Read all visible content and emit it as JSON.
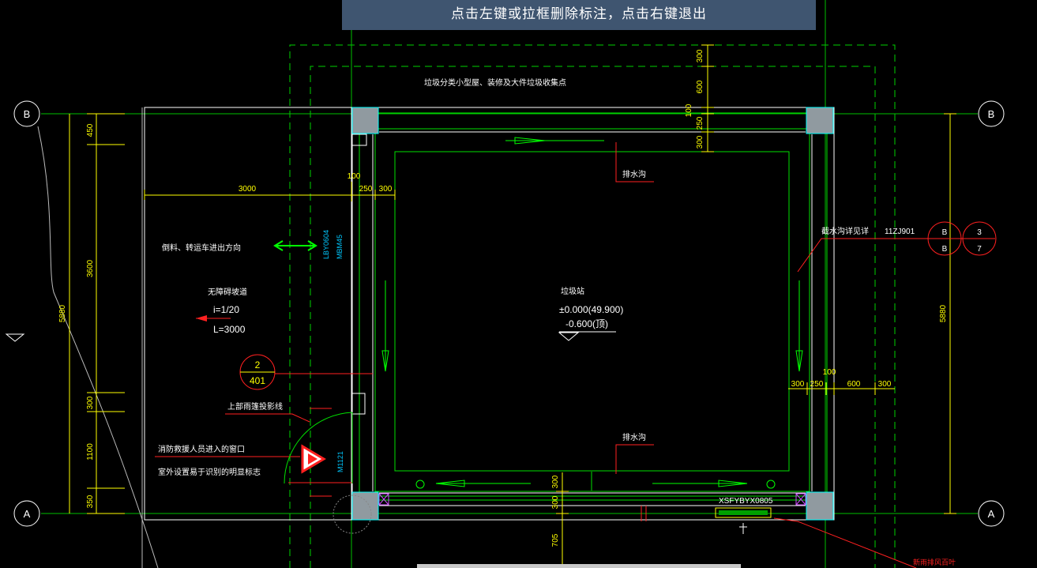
{
  "tooltip": "点击左键或拉框删除标注，点击右键退出",
  "axis": {
    "top_left": "B",
    "top_right": "B",
    "bottom_left": "A",
    "bottom_right": "A"
  },
  "dims": {
    "left_450": "450",
    "left_3600": "3600",
    "left_5880": "5880",
    "left_300": "300",
    "left_1100": "1100",
    "left_350": "350",
    "top_3000": "3000",
    "top_250": "250",
    "top_300": "300",
    "top_100": "100",
    "vtop_300a": "300",
    "vtop_600": "600",
    "vtop_100": "100",
    "vtop_250": "250",
    "vtop_300b": "300",
    "right_5880": "5880",
    "r_300a": "300",
    "r_250": "250",
    "r_100": "100",
    "r_600": "600",
    "r_300b": "300",
    "bottom_300a": "300",
    "bottom_300b": "300",
    "bottom_705": "705"
  },
  "labels": {
    "recycle_note": "垃圾分类小型屋、装修及大件垃圾收集点",
    "drain_top": "排水沟",
    "drain_bottom": "排水沟",
    "trench_right": "截水沟详见详",
    "detail_code": "11ZJ901",
    "detail_b_top": "B",
    "detail_b_bottom": "B",
    "detail_3": "3",
    "detail_7": "7",
    "station": "垃圾站",
    "elev_main": "±0.000(49.900)",
    "elev_sub": "-0.600(顶)",
    "truck_dir": "倒料、转运车进出方向",
    "door_lbl_1": "LBY0604",
    "door_lbl_2": "MBM45",
    "ramp_title": "无障碍坡道",
    "ramp_slope": "i=1/20",
    "ramp_len": "L=3000",
    "callout_top": "2",
    "callout_bottom": "401",
    "canopy": "上部雨篷投影线",
    "fire_entry_1": "消防救援人员进入的窗口",
    "fire_entry_2": "室外设置易于识别的明显标志",
    "door_m": "M1121",
    "equip_code": "XSFYBYX0805",
    "bottom_note": "新雨排风百叶"
  }
}
